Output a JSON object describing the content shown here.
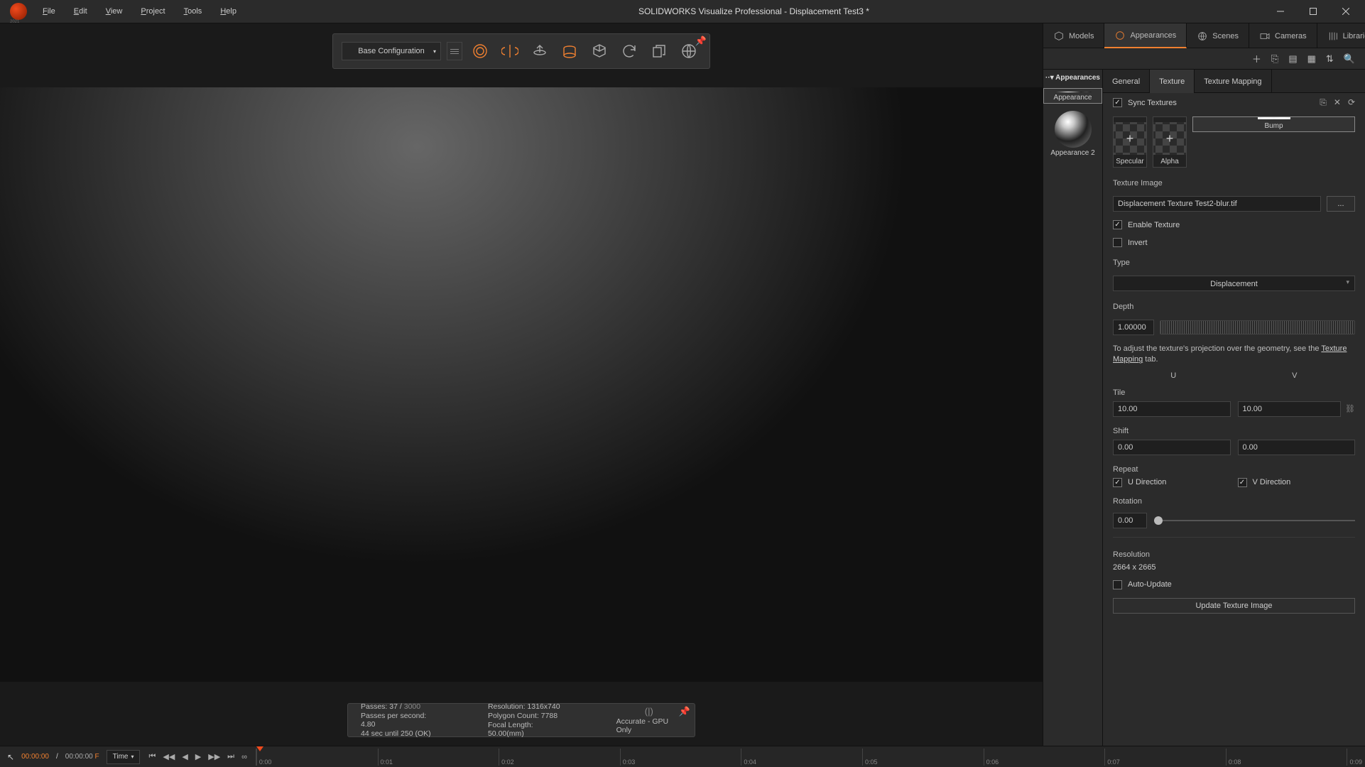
{
  "title": "SOLIDWORKS Visualize Professional - Displacement Test3 *",
  "menu": [
    "File",
    "Edit",
    "View",
    "Project",
    "Tools",
    "Help"
  ],
  "viewport": {
    "config": "Base Configuration",
    "stats": {
      "passes_label": "Passes:",
      "passes_cur": "37",
      "passes_sep": "/",
      "passes_tot": "3000",
      "pps": "Passes per second: 4.80",
      "eta": "44 sec until 250 (OK)",
      "res": "Resolution: 1316x740",
      "poly": "Polygon Count: 7788",
      "fl": "Focal Length: 50.00(mm)",
      "mode": "Accurate - GPU Only"
    }
  },
  "rtabs": [
    "Models",
    "Appearances",
    "Scenes",
    "Cameras",
    "Libraries"
  ],
  "app_hdr": "Appearances",
  "apps": [
    {
      "name": "Appearance"
    },
    {
      "name": "Appearance 2"
    }
  ],
  "subtabs": [
    "General",
    "Texture",
    "Texture Mapping"
  ],
  "tex": {
    "sync": "Sync Textures",
    "slots": [
      {
        "name": "Specular"
      },
      {
        "name": "Alpha"
      },
      {
        "name": "Bump"
      }
    ],
    "image_label": "Texture Image",
    "image_file": "Displacement Texture Test2-blur.tif",
    "browse": "...",
    "enable": "Enable Texture",
    "invert": "Invert",
    "type_label": "Type",
    "type_value": "Displacement",
    "depth_label": "Depth",
    "depth_value": "1.00000",
    "hint_pre": "To adjust the texture's projection over the geometry, see the ",
    "hint_link": "Texture Mapping",
    "hint_post": " tab.",
    "col_u": "U",
    "col_v": "V",
    "tile_label": "Tile",
    "tile_u": "10.00",
    "tile_v": "10.00",
    "shift_label": "Shift",
    "shift_u": "0.00",
    "shift_v": "0.00",
    "repeat_label": "Repeat",
    "repeat_u": "U Direction",
    "repeat_v": "V Direction",
    "rot_label": "Rotation",
    "rot": "0.00",
    "res_label": "Resolution",
    "res_value": "2664 x 2665",
    "auto": "Auto-Update",
    "update_btn": "Update Texture Image"
  },
  "timeline": {
    "cur": "00:00:00",
    "sep": "/",
    "len": "00:00:00",
    "unit": "F",
    "mode": "Time",
    "ticks": [
      "0:00",
      "0:01",
      "0:02",
      "0:03",
      "0:04",
      "0:05",
      "0:06",
      "0:07",
      "0:08",
      "0:09"
    ]
  }
}
